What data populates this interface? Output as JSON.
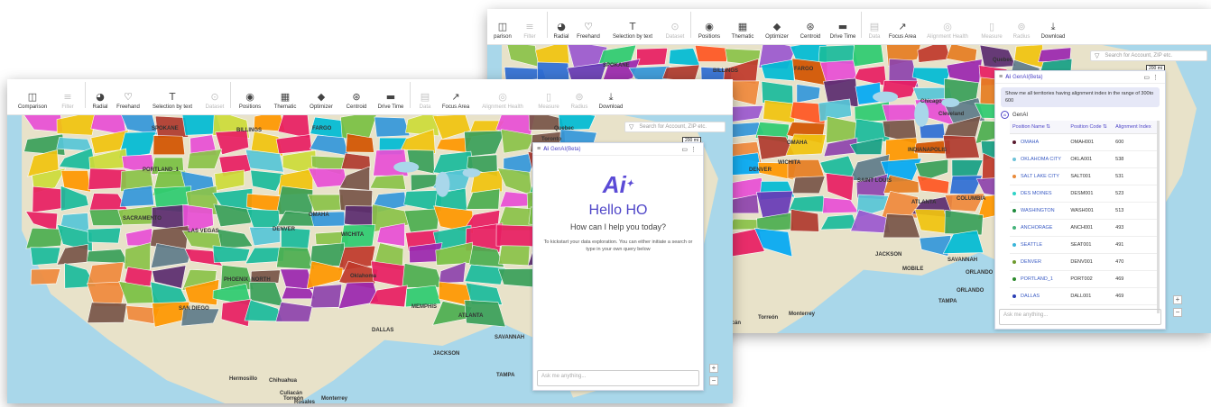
{
  "toolbar_back": [
    {
      "label": "parison",
      "icon": "comparison-icon",
      "disabled": false
    },
    {
      "label": "Filter",
      "icon": "filter-icon",
      "disabled": true
    },
    {
      "label": "Radial",
      "icon": "radial-icon",
      "disabled": false
    },
    {
      "label": "Freehand",
      "icon": "freehand-icon",
      "disabled": false
    },
    {
      "label": "Selection by text",
      "icon": "text-icon",
      "disabled": false
    },
    {
      "label": "Dataset",
      "icon": "dataset-icon",
      "disabled": true
    },
    {
      "label": "Positions",
      "icon": "positions-icon",
      "disabled": false
    },
    {
      "label": "Thematic",
      "icon": "thematic-icon",
      "disabled": false
    },
    {
      "label": "Optimizer",
      "icon": "optimizer-icon",
      "disabled": false
    },
    {
      "label": "Centroid",
      "icon": "centroid-icon",
      "disabled": false
    },
    {
      "label": "Drive Time",
      "icon": "car-icon",
      "disabled": false
    },
    {
      "label": "Data",
      "icon": "data-icon",
      "disabled": true
    },
    {
      "label": "Focus Area",
      "icon": "chart-icon",
      "disabled": false
    },
    {
      "label": "Alignment Health",
      "icon": "health-icon",
      "disabled": true
    },
    {
      "label": "Measure",
      "icon": "measure-icon",
      "disabled": true
    },
    {
      "label": "Radius",
      "icon": "radius-icon",
      "disabled": true
    },
    {
      "label": "Download",
      "icon": "download-icon",
      "disabled": false
    }
  ],
  "toolbar_front": [
    {
      "label": "Comparison",
      "icon": "comparison-icon",
      "disabled": false
    },
    {
      "label": "Filter",
      "icon": "filter-icon",
      "disabled": true
    },
    {
      "label": "Radial",
      "icon": "radial-icon",
      "disabled": false
    },
    {
      "label": "Freehand",
      "icon": "freehand-icon",
      "disabled": false
    },
    {
      "label": "Selection by text",
      "icon": "text-icon",
      "disabled": false
    },
    {
      "label": "Dataset",
      "icon": "dataset-icon",
      "disabled": true
    },
    {
      "label": "Positions",
      "icon": "positions-icon",
      "disabled": false
    },
    {
      "label": "Thematic",
      "icon": "thematic-icon",
      "disabled": false
    },
    {
      "label": "Optimizer",
      "icon": "optimizer-icon",
      "disabled": false
    },
    {
      "label": "Centroid",
      "icon": "centroid-icon",
      "disabled": false
    },
    {
      "label": "Drive Time",
      "icon": "car-icon",
      "disabled": false
    },
    {
      "label": "Data",
      "icon": "data-icon",
      "disabled": true
    },
    {
      "label": "Focus Area",
      "icon": "chart-icon",
      "disabled": false
    },
    {
      "label": "Alignment Health",
      "icon": "health-icon",
      "disabled": true
    },
    {
      "label": "Measure",
      "icon": "measure-icon",
      "disabled": true
    },
    {
      "label": "Radius",
      "icon": "radius-icon",
      "disabled": true
    },
    {
      "label": "Download",
      "icon": "download-icon",
      "disabled": false
    }
  ],
  "search_placeholder": "Search for Account, ZIP etc.",
  "scale_label": "200 mi",
  "genai_title": "GenAI(Beta)",
  "front_panel": {
    "hello": "Hello HO",
    "help": "How can I help you today?",
    "hint": "To kickstart your data exploration. You can either initiate a search or type in your own query below",
    "ask_placeholder": "Ask me anything..."
  },
  "back_panel": {
    "user_query": "Show me all territories having alignment index in the range of 300to 600",
    "responder": "GenAI",
    "columns": [
      "Position Name",
      "Position Code",
      "Alignment Index"
    ],
    "rows": [
      {
        "name": "OMAHA",
        "code": "OMAH001",
        "index": "600",
        "color": "#5a1a2e"
      },
      {
        "name": "OKLAHOMA CITY",
        "code": "OKLA001",
        "index": "538",
        "color": "#6ec3d8"
      },
      {
        "name": "SALT LAKE CITY",
        "code": "SALT001",
        "index": "531",
        "color": "#e98a3a"
      },
      {
        "name": "DES MOINES",
        "code": "DESM001",
        "index": "523",
        "color": "#2fd3c7"
      },
      {
        "name": "WASHINGTON",
        "code": "WASH001",
        "index": "513",
        "color": "#1e8a3c"
      },
      {
        "name": "ANCHORAGE",
        "code": "ANCH001",
        "index": "493",
        "color": "#44b37a"
      },
      {
        "name": "SEATTLE",
        "code": "SEAT001",
        "index": "491",
        "color": "#3ab5d9"
      },
      {
        "name": "DENVER",
        "code": "DENV001",
        "index": "470",
        "color": "#6e9a2e"
      },
      {
        "name": "PORTLAND_1",
        "code": "PORT002",
        "index": "469",
        "color": "#2c8a2c"
      },
      {
        "name": "DALLAS",
        "code": "DALL001",
        "index": "469",
        "color": "#2b3fb5"
      }
    ],
    "ask_placeholder": "Ask me anything..."
  },
  "map_labels_front": [
    "SPOKANE",
    "BILLINGS",
    "FARGO",
    "PORTLAND_1",
    "LAS VEGAS",
    "PHOENIX_NORTH",
    "SAN DIEGO",
    "Hermosillo",
    "Chihuahua",
    "Torreón",
    "Monterrey",
    "Culiacán",
    "Rosales",
    "OMAHA",
    "DENVER",
    "WICHITA",
    "SACRAMENTO",
    "Oklahoma",
    "MEMPHIS",
    "DALLAS",
    "JACKSON",
    "SAVANNAH",
    "TAMPA",
    "ATLANTA",
    "Toronto",
    "Quebec"
  ],
  "map_labels_back": [
    "SPOKANE",
    "BILLINGS",
    "FARGO",
    "SAINT LOUIS",
    "WICHITA",
    "OMAHA",
    "DENVER",
    "JACKSON",
    "MOBILE",
    "SAVANNAH",
    "ORLANDO",
    "TAMPA",
    "Chihuahua",
    "Torreón",
    "Monterrey",
    "Culiacán",
    "Quebec",
    "Chicago",
    "Cleveland",
    "INDIANAPOLIS",
    "ATLANTA",
    "COLUMBIA",
    "ORLANDO"
  ],
  "zoom_plus": "+",
  "zoom_minus": "−"
}
